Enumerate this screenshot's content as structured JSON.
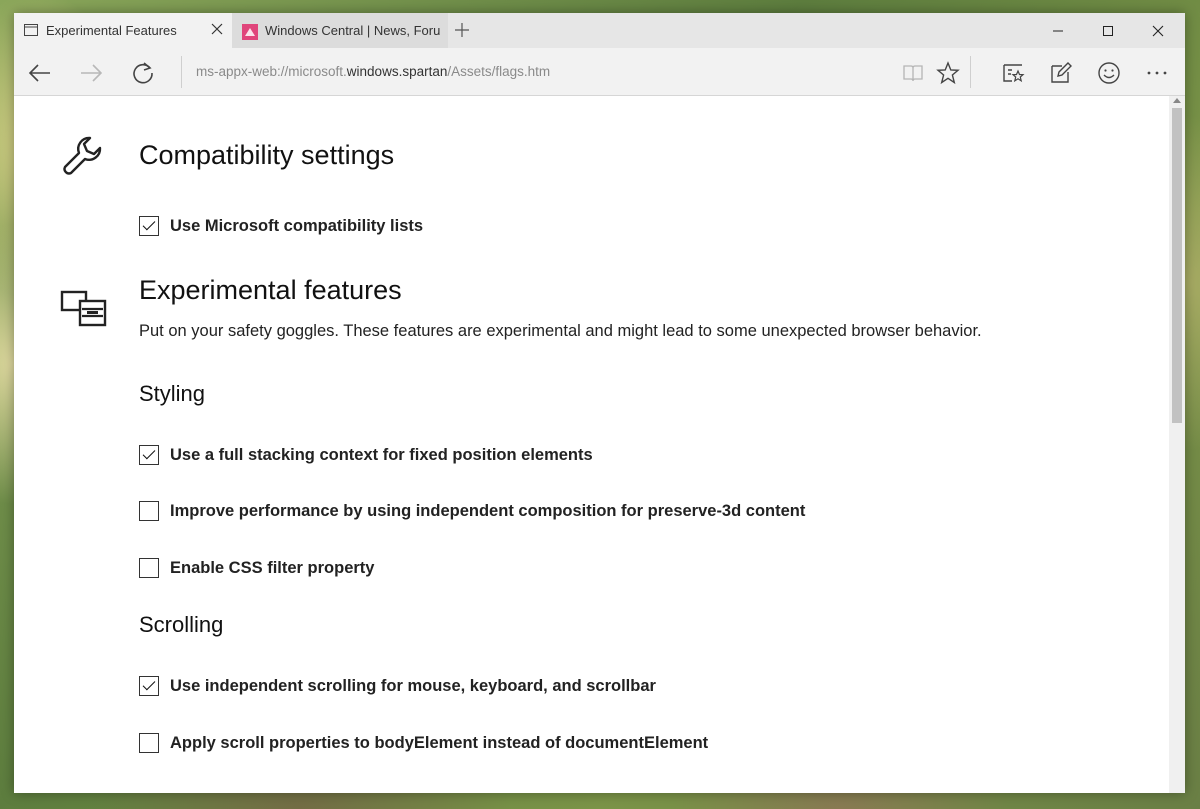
{
  "tabs": [
    {
      "title": "Experimental Features",
      "active": true
    },
    {
      "title": "Windows Central | News, Forur",
      "active": false
    }
  ],
  "address": {
    "prefix": "ms-appx-web://microsoft.",
    "host": "windows.spartan",
    "suffix": "/Assets/flags.htm"
  },
  "page": {
    "compat": {
      "title": "Compatibility settings",
      "options": [
        {
          "label": "Use Microsoft compatibility lists",
          "checked": true
        }
      ]
    },
    "experimental": {
      "title": "Experimental features",
      "description": "Put on your safety goggles. These features are experimental and might lead to some unexpected browser behavior."
    },
    "styling": {
      "title": "Styling",
      "options": [
        {
          "label": "Use a full stacking context for fixed position elements",
          "checked": true
        },
        {
          "label": "Improve performance by using independent composition for preserve-3d content",
          "checked": false
        },
        {
          "label": "Enable CSS filter property",
          "checked": false
        }
      ]
    },
    "scrolling": {
      "title": "Scrolling",
      "options": [
        {
          "label": "Use independent scrolling for mouse, keyboard, and scrollbar",
          "checked": true
        },
        {
          "label": "Apply scroll properties to bodyElement instead of documentElement",
          "checked": false
        }
      ]
    }
  },
  "colors": {
    "accent": "#e0457b",
    "text": "#222222"
  }
}
